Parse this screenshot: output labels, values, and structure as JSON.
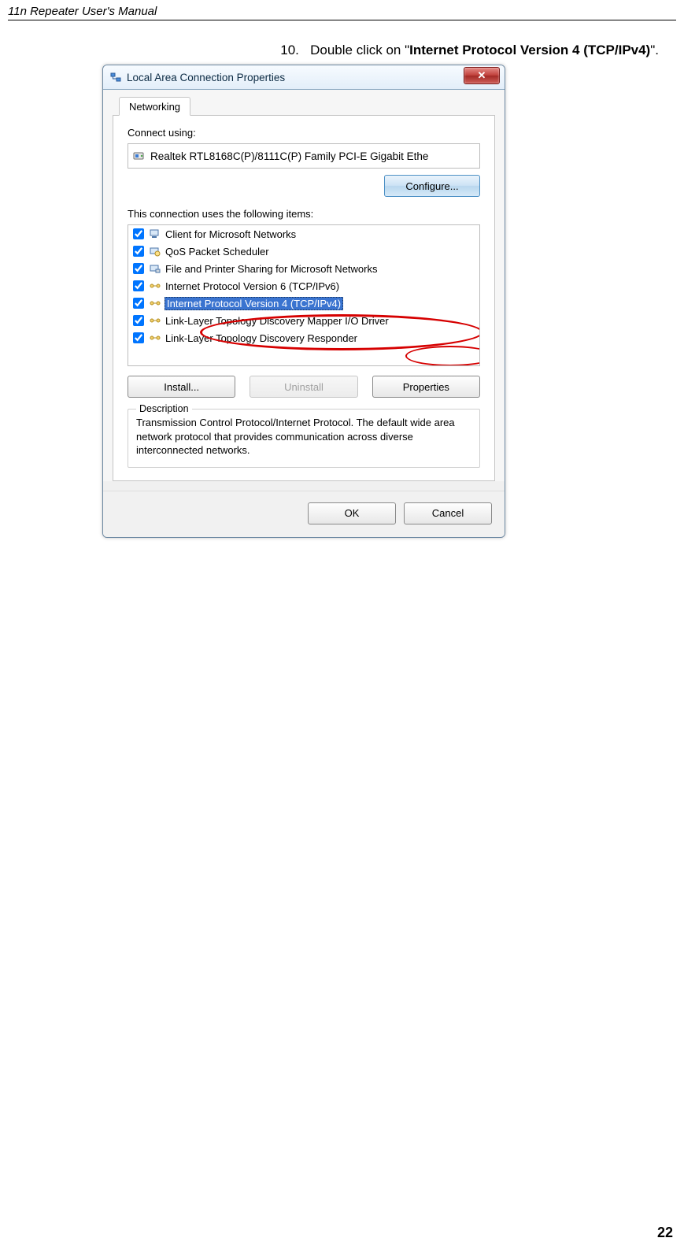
{
  "header": "11n Repeater User's Manual",
  "instruction": {
    "number": "10.",
    "prefix": "Double click on \"",
    "bold": "Internet Protocol Version 4 (TCP/IPv4)",
    "suffix": "\"."
  },
  "dialog": {
    "title": "Local Area Connection Properties",
    "tab": "Networking",
    "connect_using_label": "Connect using:",
    "adapter": "Realtek RTL8168C(P)/8111C(P) Family PCI-E Gigabit Ethe",
    "configure_btn": "Configure...",
    "uses_label": "This connection uses the following items:",
    "items": [
      {
        "label": "Client for Microsoft Networks",
        "icon": "client"
      },
      {
        "label": "QoS Packet Scheduler",
        "icon": "qos"
      },
      {
        "label": "File and Printer Sharing for Microsoft Networks",
        "icon": "share"
      },
      {
        "label": "Internet Protocol Version 6 (TCP/IPv6)",
        "icon": "proto"
      },
      {
        "label": "Internet Protocol Version 4 (TCP/IPv4)",
        "icon": "proto"
      },
      {
        "label": "Link-Layer Topology Discovery Mapper I/O Driver",
        "icon": "lltd"
      },
      {
        "label": "Link-Layer Topology Discovery Responder",
        "icon": "lltd"
      }
    ],
    "install_btn": "Install...",
    "uninstall_btn": "Uninstall",
    "properties_btn": "Properties",
    "desc_legend": "Description",
    "desc_text": "Transmission Control Protocol/Internet Protocol. The default wide area network protocol that provides communication across diverse interconnected networks.",
    "ok_btn": "OK",
    "cancel_btn": "Cancel"
  },
  "page_number": "22"
}
